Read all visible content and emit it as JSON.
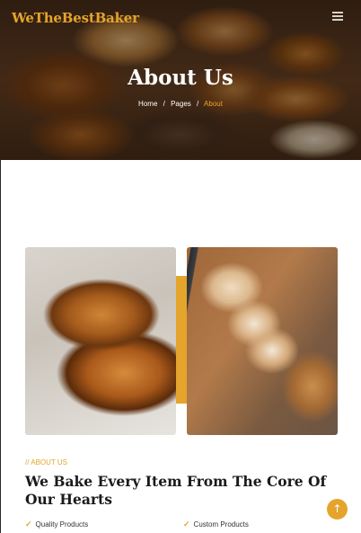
{
  "header": {
    "logo": "WeTheBestBaker",
    "menu_icon": "hamburger-menu-icon"
  },
  "hero": {
    "title": "About Us",
    "breadcrumb": [
      "Home",
      "Pages",
      "About"
    ],
    "breadcrumb_separator": "/"
  },
  "about": {
    "tag": "// ABOUT US",
    "heading": "We Bake Every Item From The Core Of Our Hearts",
    "features": [
      "Quality Products",
      "Custom Products"
    ]
  },
  "scroll_top": {
    "icon": "arrow-up-icon",
    "glyph": "↑"
  },
  "colors": {
    "accent": "#e5a42b",
    "heading": "#1a1a1a",
    "text": "#333333"
  }
}
